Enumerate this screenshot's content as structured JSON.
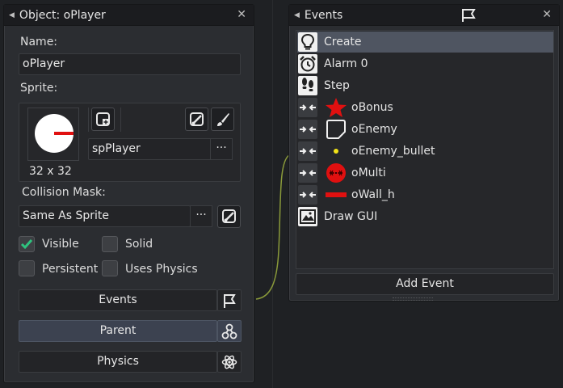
{
  "object_panel": {
    "title": "Object: oPlayer",
    "close": "✕",
    "name_label": "Name:",
    "name_value": "oPlayer",
    "sprite_label": "Sprite:",
    "sprite_size": "32 x 32",
    "sprite_name": "spPlayer",
    "dots": "···",
    "collision_label": "Collision Mask:",
    "collision_value": "Same As Sprite",
    "checkboxes": {
      "visible": {
        "label": "Visible",
        "checked": true
      },
      "solid": {
        "label": "Solid",
        "checked": false
      },
      "persistent": {
        "label": "Persistent",
        "checked": false
      },
      "uses_physics": {
        "label": "Uses Physics",
        "checked": false
      }
    },
    "buttons": {
      "events": "Events",
      "parent": "Parent",
      "physics": "Physics"
    }
  },
  "events_panel": {
    "title": "Events",
    "close": "✕",
    "events": [
      {
        "label": "Create",
        "icon": "lightbulb-icon"
      },
      {
        "label": "Alarm 0",
        "icon": "alarm-clock-icon"
      },
      {
        "label": "Step",
        "icon": "footsteps-icon"
      },
      {
        "label": "oBonus",
        "icon": "collision-icon"
      },
      {
        "label": "oEnemy",
        "icon": "collision-icon"
      },
      {
        "label": "oEnemy_bullet",
        "icon": "collision-icon"
      },
      {
        "label": "oMulti",
        "icon": "collision-icon"
      },
      {
        "label": "oWall_h",
        "icon": "collision-icon"
      },
      {
        "label": "Draw GUI",
        "icon": "draw-gui-icon"
      }
    ],
    "add_event": "Add Event"
  },
  "colors": {
    "accent_green": "#2ec27e",
    "selected_row": "#4f5561",
    "red": "#e01010",
    "yellow": "#f2e318"
  }
}
